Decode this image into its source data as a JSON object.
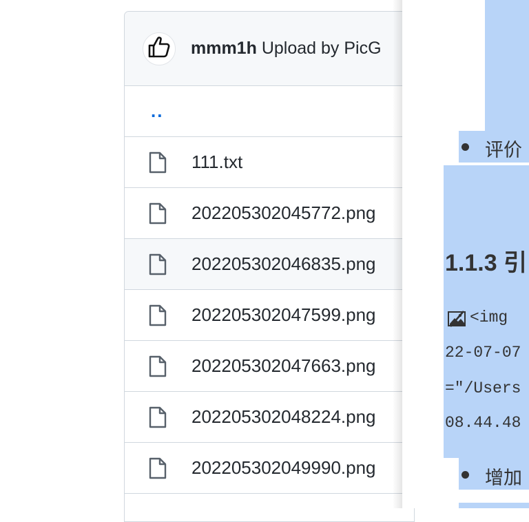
{
  "repo_panel": {
    "commit_author": "mmm1h",
    "commit_message": "Upload by PicG",
    "parent_dir": "..",
    "files": [
      "111.txt",
      "202205302045772.png",
      "202205302046835.png",
      "202205302047599.png",
      "202205302047663.png",
      "202205302048224.png",
      "202205302049990.png"
    ],
    "hovered_row": 2
  },
  "doc_panel": {
    "bullet_1": "评价",
    "heading": "1.1.3 引",
    "code_lines": [
      "<img",
      "22-07-07",
      "=\"/Users",
      "08.44.48"
    ],
    "bullet_2": "增加",
    "highlight_color": "#b8d4f8"
  }
}
